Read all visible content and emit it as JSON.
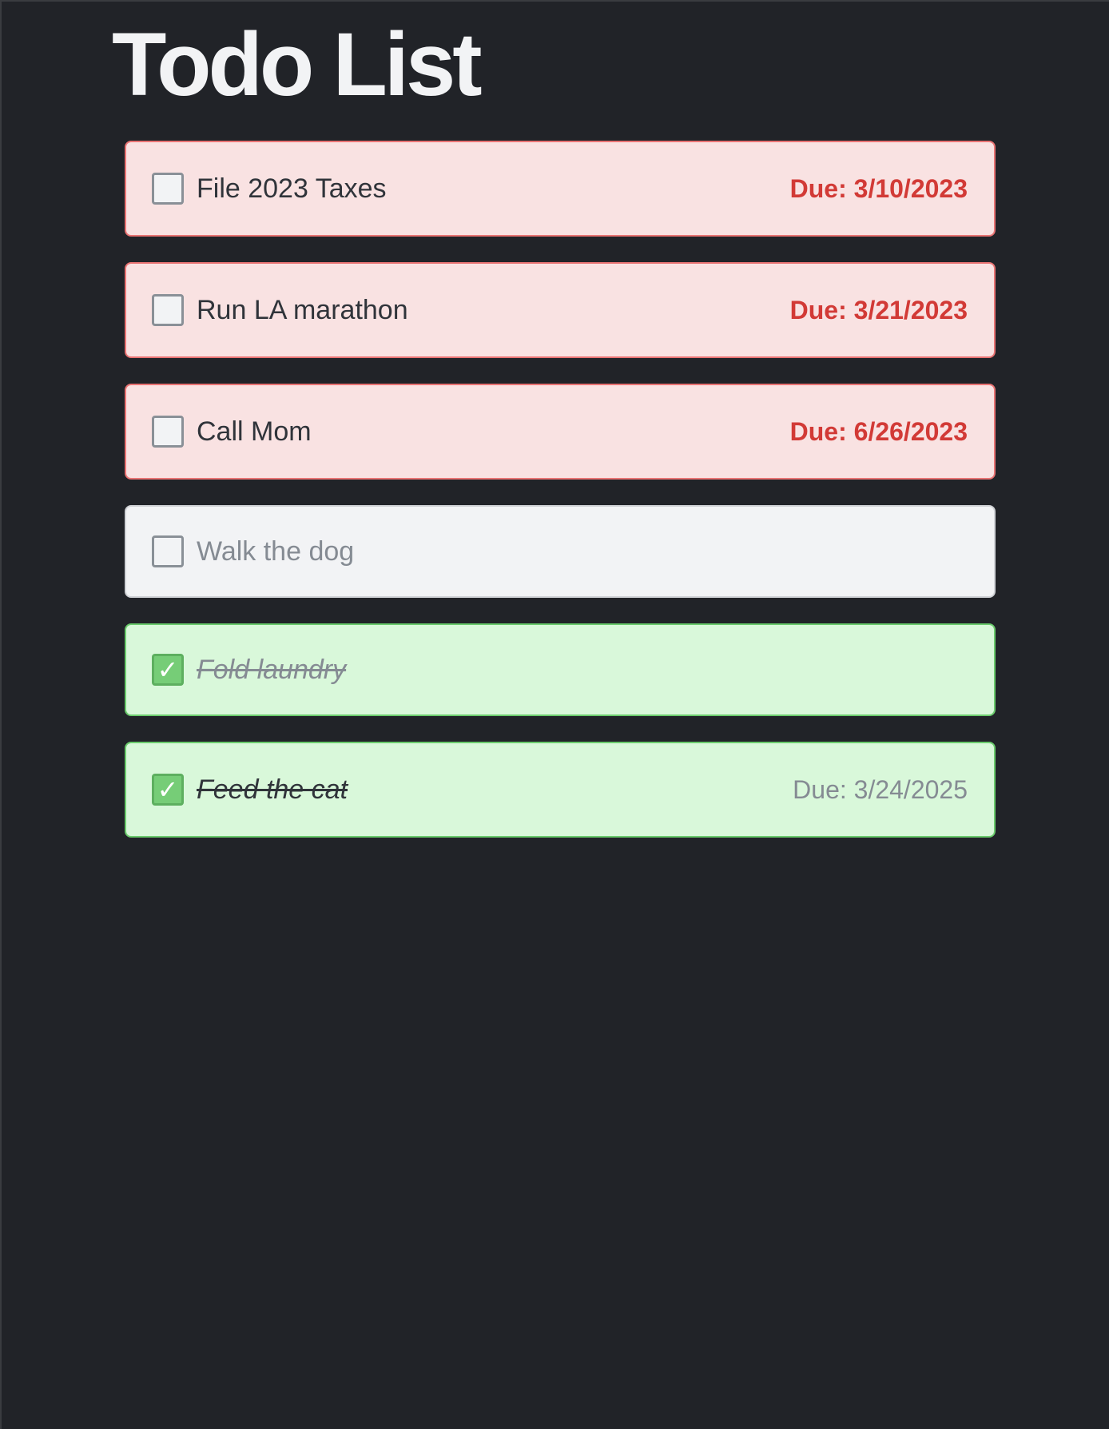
{
  "title": "Todo List",
  "colors": {
    "overdue": "#d23a36",
    "done": "#76cd77",
    "background": "#212328"
  },
  "items": [
    {
      "label": "File 2023 Taxes",
      "due": "Due: 3/10/2023",
      "checked": false,
      "state": "overdue"
    },
    {
      "label": "Run LA marathon",
      "due": "Due: 3/21/2023",
      "checked": false,
      "state": "overdue"
    },
    {
      "label": "Call Mom",
      "due": "Due: 6/26/2023",
      "checked": false,
      "state": "overdue"
    },
    {
      "label": "Walk the dog",
      "checked": false,
      "state": "plain"
    },
    {
      "label": "Fold laundry",
      "checked": true,
      "state": "done"
    },
    {
      "label": "Feed the cat",
      "due": "Due: 3/24/2025",
      "checked": true,
      "state": "done"
    }
  ]
}
